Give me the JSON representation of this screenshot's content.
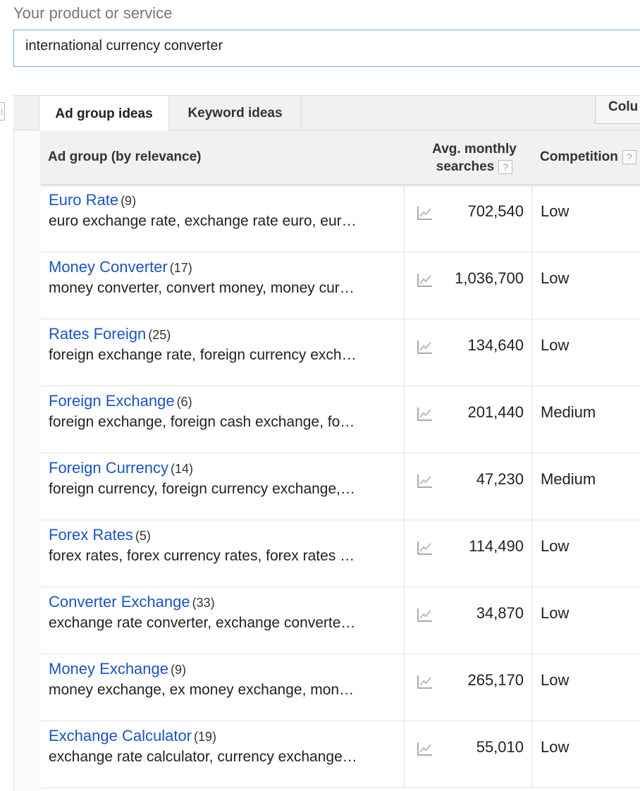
{
  "product": {
    "label": "Your product or service",
    "value": "international currency converter"
  },
  "tabs": [
    {
      "label": "Ad group ideas",
      "active": true
    },
    {
      "label": "Keyword ideas",
      "active": false
    }
  ],
  "columns_button": "Colu",
  "table": {
    "headers": {
      "group": "Ad group (by relevance)",
      "avg_line1": "Avg. monthly",
      "avg_line2": "searches",
      "competition": "Competition",
      "help": "?"
    },
    "rows": [
      {
        "name": "Euro Rate",
        "count": "(9)",
        "keywords": "euro exchange rate, exchange rate euro, eur…",
        "searches": "702,540",
        "competition": "Low"
      },
      {
        "name": "Money Converter",
        "count": "(17)",
        "keywords": "money converter, convert money, money cur…",
        "searches": "1,036,700",
        "competition": "Low"
      },
      {
        "name": "Rates Foreign",
        "count": "(25)",
        "keywords": "foreign exchange rate, foreign currency exch…",
        "searches": "134,640",
        "competition": "Low"
      },
      {
        "name": "Foreign Exchange",
        "count": "(6)",
        "keywords": "foreign exchange, foreign cash exchange, fo…",
        "searches": "201,440",
        "competition": "Medium"
      },
      {
        "name": "Foreign Currency",
        "count": "(14)",
        "keywords": "foreign currency, foreign currency exchange,…",
        "searches": "47,230",
        "competition": "Medium"
      },
      {
        "name": "Forex Rates",
        "count": "(5)",
        "keywords": "forex rates, forex currency rates, forex rates …",
        "searches": "114,490",
        "competition": "Low"
      },
      {
        "name": "Converter Exchange",
        "count": "(33)",
        "keywords": "exchange rate converter, exchange converte…",
        "searches": "34,870",
        "competition": "Low"
      },
      {
        "name": "Money Exchange",
        "count": "(9)",
        "keywords": "money exchange, ex money exchange, mon…",
        "searches": "265,170",
        "competition": "Low"
      },
      {
        "name": "Exchange Calculator",
        "count": "(19)",
        "keywords": "exchange rate calculator, currency exchange…",
        "searches": "55,010",
        "competition": "Low"
      }
    ]
  },
  "colors": {
    "link": "#1a54c4",
    "input_border": "#7aa2d6",
    "header_bg": "#f1f1f1"
  },
  "icons": {
    "trend": "trend-chart-icon",
    "help": "help-icon"
  }
}
